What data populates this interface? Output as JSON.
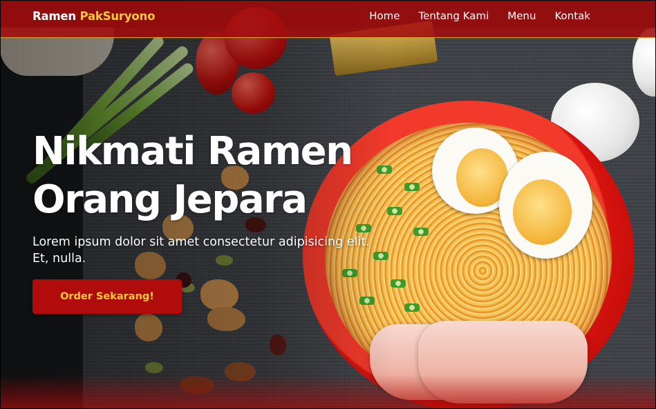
{
  "brand": {
    "name_part1": "Ramen ",
    "name_part2": "PakSuryono"
  },
  "nav": {
    "items": [
      "Home",
      "Tentang Kami",
      "Menu",
      "Kontak"
    ]
  },
  "hero": {
    "title_line1": "Nikmati Ramen",
    "title_line2": "Orang Jepara",
    "description": "Lorem ipsum dolor sit amet consectetur adipisicing elit. Et, nulla.",
    "cta_label": "Order Sekarang!"
  },
  "colors": {
    "navbar": "#a30d0d",
    "accent": "#ffc936",
    "button": "#b00c0c"
  }
}
